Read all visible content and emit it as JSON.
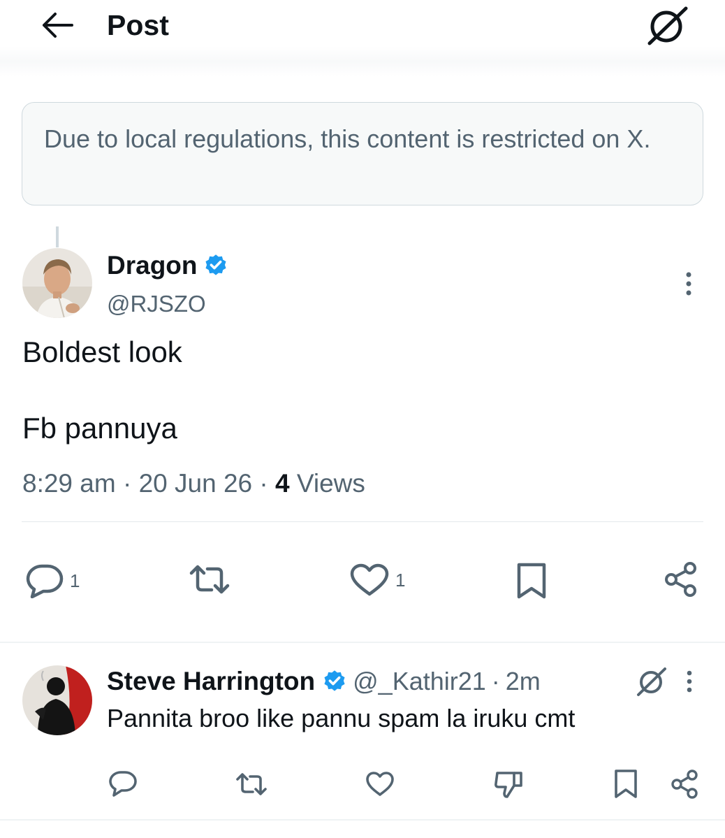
{
  "header": {
    "title": "Post",
    "back_icon": "arrow-left-icon",
    "grok_icon": "grok-icon"
  },
  "notice": {
    "text": "Due to local regulations, this content is restricted on X."
  },
  "post": {
    "author_name": "Dragon",
    "author_handle": "@RJSZO",
    "verified": true,
    "verified_color": "#1d9bf0",
    "text_line1": "Boldest look",
    "text_line2": "Fb pannuya",
    "time": "8:29 am",
    "date": "20 Jun 26",
    "separator": "·",
    "views_count": "4",
    "views_label": "Views",
    "actions": {
      "reply_count": "1",
      "like_count": "1"
    }
  },
  "reply": {
    "author_name": "Steve Harrington",
    "author_handle": "@_Kathir21",
    "separator": "·",
    "age": "2m",
    "verified": true,
    "text": "Pannita broo like pannu spam la iruku cmt"
  },
  "colors": {
    "text_primary": "#0f1419",
    "text_secondary": "#536471",
    "accent": "#1d9bf0",
    "border": "#cfd9de",
    "notice_bg": "#f7f9f9"
  }
}
